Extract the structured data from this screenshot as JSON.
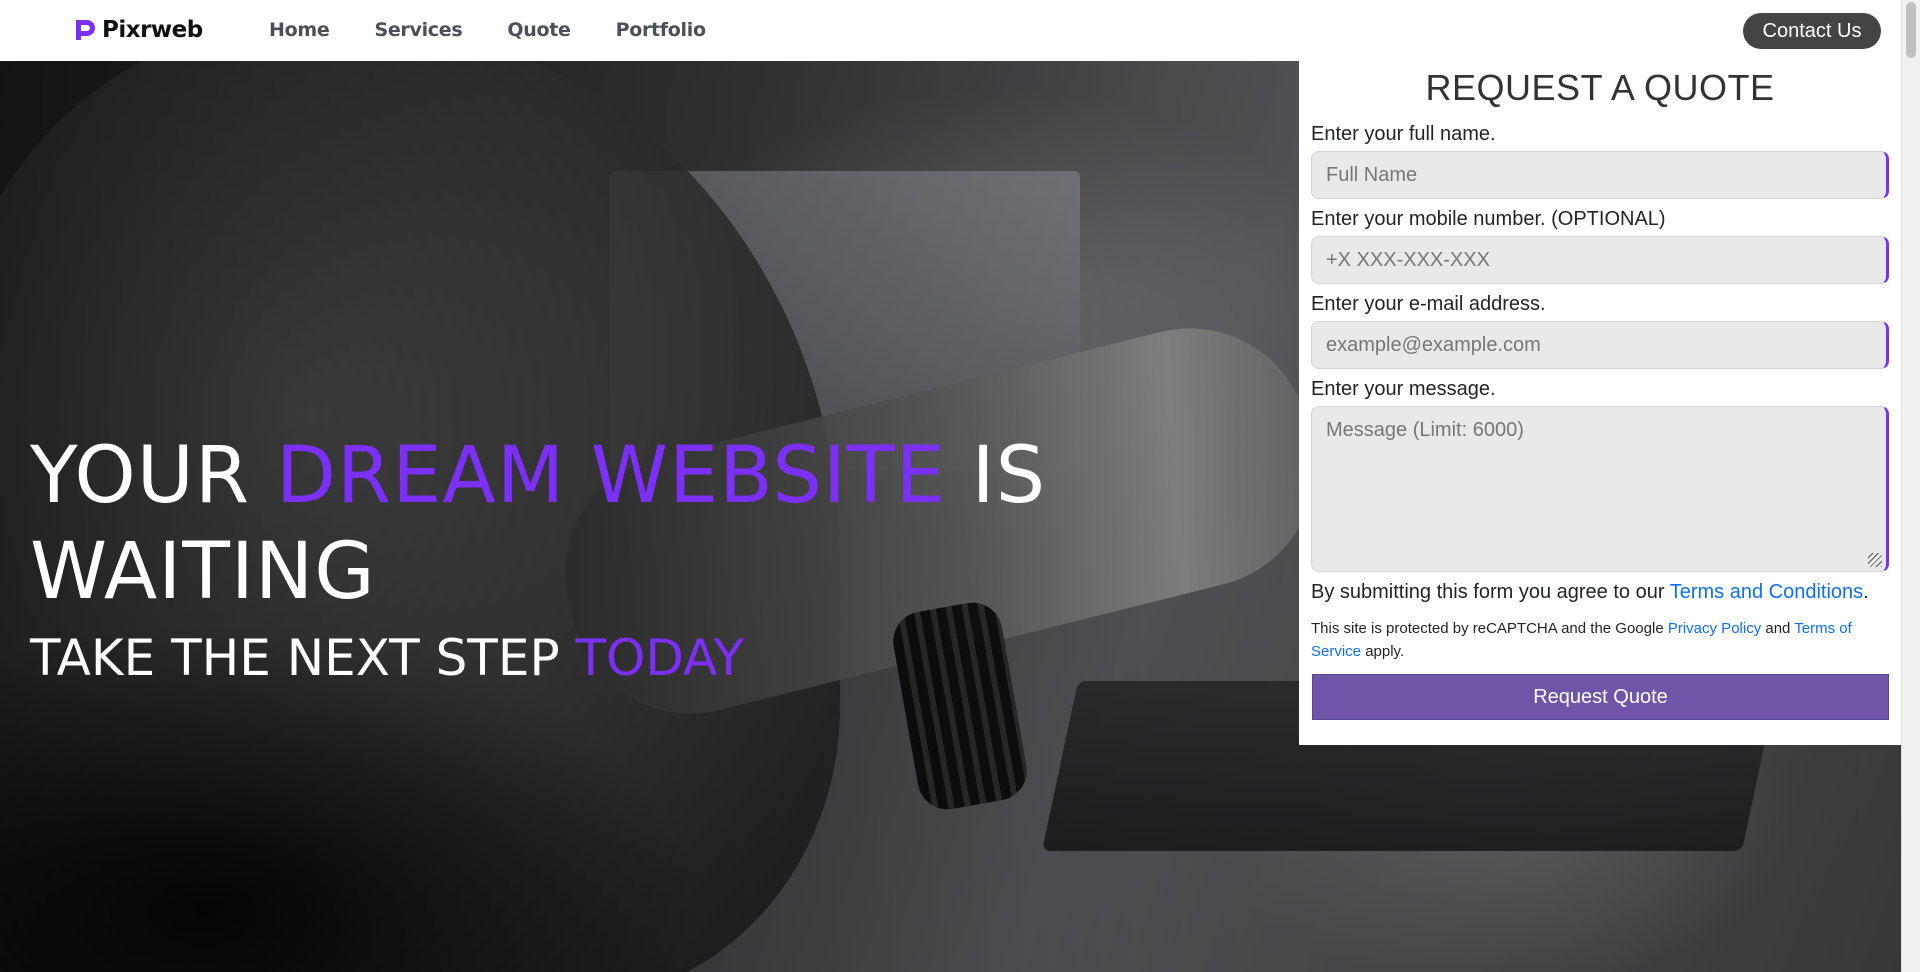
{
  "header": {
    "logo_text": "Pixrweb",
    "nav": [
      "Home",
      "Services",
      "Quote",
      "Portfolio"
    ],
    "contact_label": "Contact Us"
  },
  "hero": {
    "line1_a": "YOUR ",
    "line1_accent": "DREAM WEBSITE",
    "line1_b": " IS",
    "line2": "WAITING",
    "sub_a": "TAKE THE NEXT STEP ",
    "sub_accent": "TODAY"
  },
  "form": {
    "title": "REQUEST A QUOTE",
    "name_label": "Enter your full name.",
    "name_placeholder": "Full Name",
    "phone_label": "Enter your mobile number. (OPTIONAL)",
    "phone_placeholder": "+X XXX-XXX-XXX",
    "email_label": "Enter your e-mail address.",
    "email_placeholder": "example@example.com",
    "message_label": "Enter your message.",
    "message_placeholder": "Message (Limit: 6000)",
    "agree_text": "By submitting this form you agree to our ",
    "terms_link": "Terms and Conditions",
    "agree_end": ".",
    "recaptcha_a": "This site is protected by reCAPTCHA and the Google ",
    "privacy_link": "Privacy Policy",
    "recaptcha_and": " and ",
    "tos_link": "Terms of Service",
    "recaptcha_end": " apply.",
    "submit_label": "Request Quote"
  },
  "colors": {
    "accent": "#7b2ff7",
    "button": "#6f55a8",
    "link": "#0d6efd",
    "contact_bg": "#444444"
  }
}
